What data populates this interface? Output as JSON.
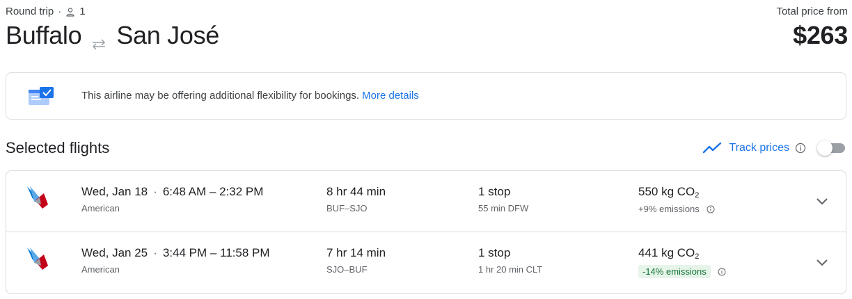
{
  "header": {
    "trip_type": "Round trip",
    "separator": "·",
    "passengers": "1",
    "origin": "Buffalo",
    "destination": "San José",
    "price_label": "Total price from",
    "price": "$263"
  },
  "banner": {
    "text": "This airline may be offering additional flexibility for bookings.",
    "link": "More details"
  },
  "selected": {
    "title": "Selected flights",
    "track_label": "Track prices",
    "track_enabled": false
  },
  "flights": [
    {
      "date": "Wed, Jan 18",
      "dot": "·",
      "times": "6:48 AM – 2:32 PM",
      "airline": "American",
      "duration": "8 hr 44 min",
      "route": "BUF–SJO",
      "stops": "1 stop",
      "layover": "55 min DFW",
      "co2_amount": "550 kg CO",
      "co2_sub": "2",
      "emissions": "+9% emissions"
    },
    {
      "date": "Wed, Jan 25",
      "dot": "·",
      "times": "3:44 PM – 11:58 PM",
      "airline": "American",
      "duration": "7 hr 14 min",
      "route": "SJO–BUF",
      "stops": "1 stop",
      "layover": "1 hr 20 min CLT",
      "co2_amount": "441 kg CO",
      "co2_sub": "2",
      "emissions": "-14% emissions"
    }
  ],
  "colors": {
    "link_blue": "#1a73e8",
    "text": "#202124",
    "muted": "#5f6368",
    "border": "#dadce0",
    "eco_green_bg": "#e6f4ea",
    "eco_green_text": "#137333",
    "airline_red": "#c30019",
    "airline_blue": "#0078d2"
  },
  "icons": {
    "person": "person-icon",
    "swap": "swap-arrows-icon",
    "banner": "flexible-booking-icon",
    "trend": "trending-line-icon",
    "info": "info-icon",
    "expand": "chevron-down-icon",
    "airline_logo": "american-airlines-logo"
  }
}
